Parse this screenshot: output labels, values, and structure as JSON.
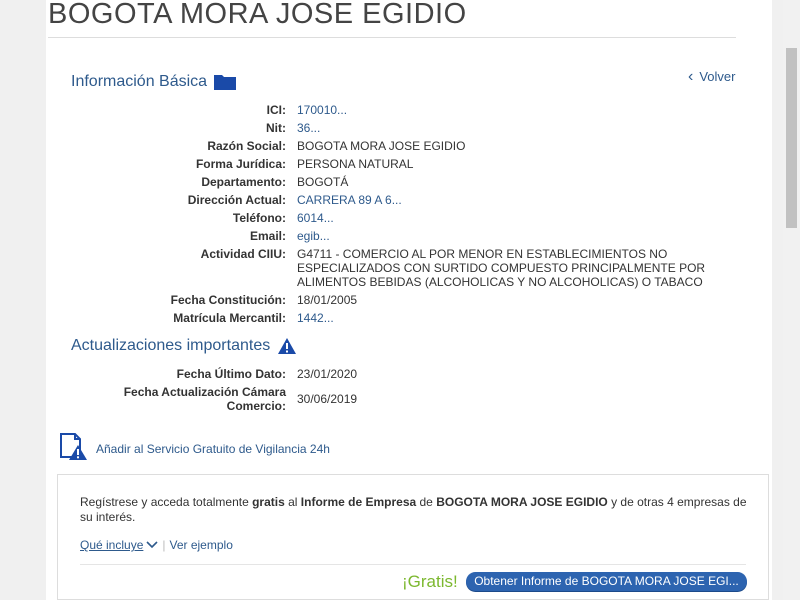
{
  "company": {
    "title": "BOGOTA MORA JOSE EGIDIO"
  },
  "basic_info": {
    "heading": "Información Básica",
    "heading_icon": "folder-icon",
    "back_label": "Volver",
    "fields": [
      {
        "label": "ICI:",
        "value": "170010...",
        "link": true
      },
      {
        "label": "Nit:",
        "value": "36...",
        "link": true
      },
      {
        "label": "Razón Social:",
        "value": "BOGOTA MORA JOSE EGIDIO",
        "link": false
      },
      {
        "label": "Forma Jurídica:",
        "value": "PERSONA NATURAL",
        "link": false
      },
      {
        "label": "Departamento:",
        "value": "BOGOTÁ",
        "link": false
      },
      {
        "label": "Dirección Actual:",
        "value": "CARRERA 89 A 6...",
        "link": true
      },
      {
        "label": "Teléfono:",
        "value": "6014...",
        "link": true
      },
      {
        "label": "Email:",
        "value": "egib...",
        "link": true
      },
      {
        "label": "Actividad CIIU:",
        "value": "G4711 - COMERCIO AL POR MENOR EN ESTABLECIMIENTOS NO ESPECIALIZADOS CON SURTIDO COMPUESTO PRINCIPALMENTE POR ALIMENTOS BEBIDAS (ALCOHOLICAS Y NO ALCOHOLICAS) O TABACO",
        "link": false
      },
      {
        "label": "Fecha Constitución:",
        "value": "18/01/2005",
        "link": false
      },
      {
        "label": "Matrícula Mercantil:",
        "value": "1442...",
        "link": true
      }
    ]
  },
  "updates": {
    "heading": "Actualizaciones importantes",
    "heading_icon": "warning-icon",
    "fields": [
      {
        "label": "Fecha Último Dato:",
        "value": "23/01/2020"
      },
      {
        "label": "Fecha Actualización Cámara Comercio:",
        "value": "30/06/2019"
      }
    ]
  },
  "vigilancia": {
    "label": "Añadir al Servicio Gratuito de Vigilancia 24h",
    "icon": "document-alert-icon"
  },
  "promo": {
    "text_parts": {
      "p1": "Regístrese y acceda totalmente ",
      "b1": "gratis",
      "p2": " al ",
      "b2": "Informe de Empresa",
      "p3": " de ",
      "b3": "BOGOTA MORA JOSE EGIDIO",
      "p4": " y de otras 4 empresas de su interés."
    },
    "what_includes": "Qué incluye",
    "see_example": "Ver ejemplo",
    "gratis": "¡Gratis!",
    "cta": "Obtener Informe de BOGOTA MORA JOSE EGI..."
  },
  "colors": {
    "link": "#2e5a8c",
    "accent_green": "#7cb82f",
    "button": "#2d64b0"
  }
}
